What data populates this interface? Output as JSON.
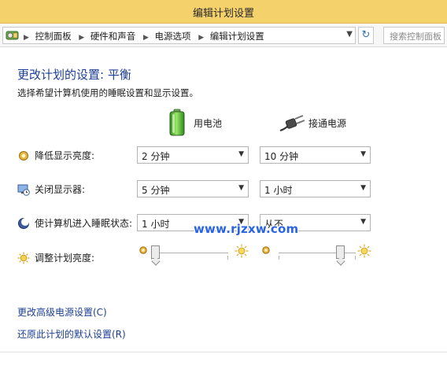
{
  "window": {
    "title": "编辑计划设置"
  },
  "addressbar": {
    "breadcrumbs": [
      "控制面板",
      "硬件和声音",
      "电源选项",
      "编辑计划设置"
    ],
    "search_placeholder": "搜索控制面板"
  },
  "page": {
    "heading": "更改计划的设置: 平衡",
    "subtitle": "选择希望计算机使用的睡眠设置和显示设置。"
  },
  "columns": {
    "battery": "用电池",
    "plugged_in": "接通电源"
  },
  "settings": [
    {
      "label": "降低显示亮度:",
      "battery": "2 分钟",
      "plugged_in": "10 分钟"
    },
    {
      "label": "关闭显示器:",
      "battery": "5 分钟",
      "plugged_in": "1 小时"
    },
    {
      "label": "使计算机进入睡眠状态:",
      "battery": "1 小时",
      "plugged_in": "从不"
    }
  ],
  "brightness": {
    "label": "调整计划亮度:",
    "battery_level": 0.05,
    "plugged_in_level": 0.8
  },
  "watermark": "www.rjzxw.com",
  "links": {
    "advanced": "更改高级电源设置(C)",
    "restore": "还原此计划的默认设置(R)"
  },
  "colors": {
    "titlebar": "#f4d16a",
    "heading": "#1c3f95",
    "link": "#1c3f95",
    "watermark": "#2a63e6"
  }
}
